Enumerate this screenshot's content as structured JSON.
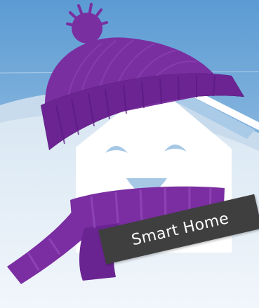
{
  "label": {
    "text": "Smart Home"
  },
  "colors": {
    "sky_top": "#6aa6d8",
    "sky_bottom": "#bcd6ec",
    "snow": "#e7f0f8",
    "hat_purple": "#7a2fa0",
    "hat_dark": "#5e1d86",
    "scarf_purple": "#7b2ea2",
    "house_white": "#ffffff",
    "roof_blue": "#a7c9e6",
    "tag_gray": "#3f3f40"
  },
  "icons": [
    "house-mascot-icon",
    "beanie-hat-icon",
    "scarf-icon",
    "pompom-icon"
  ]
}
